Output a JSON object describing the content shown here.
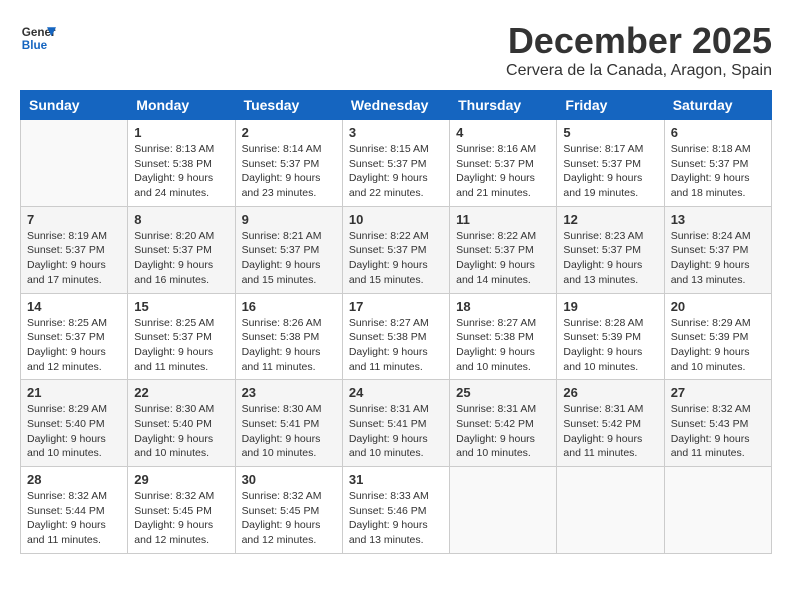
{
  "header": {
    "logo_line1": "General",
    "logo_line2": "Blue",
    "month": "December 2025",
    "location": "Cervera de la Canada, Aragon, Spain"
  },
  "weekdays": [
    "Sunday",
    "Monday",
    "Tuesday",
    "Wednesday",
    "Thursday",
    "Friday",
    "Saturday"
  ],
  "weeks": [
    [
      {
        "day": "",
        "info": ""
      },
      {
        "day": "1",
        "info": "Sunrise: 8:13 AM\nSunset: 5:38 PM\nDaylight: 9 hours\nand 24 minutes."
      },
      {
        "day": "2",
        "info": "Sunrise: 8:14 AM\nSunset: 5:37 PM\nDaylight: 9 hours\nand 23 minutes."
      },
      {
        "day": "3",
        "info": "Sunrise: 8:15 AM\nSunset: 5:37 PM\nDaylight: 9 hours\nand 22 minutes."
      },
      {
        "day": "4",
        "info": "Sunrise: 8:16 AM\nSunset: 5:37 PM\nDaylight: 9 hours\nand 21 minutes."
      },
      {
        "day": "5",
        "info": "Sunrise: 8:17 AM\nSunset: 5:37 PM\nDaylight: 9 hours\nand 19 minutes."
      },
      {
        "day": "6",
        "info": "Sunrise: 8:18 AM\nSunset: 5:37 PM\nDaylight: 9 hours\nand 18 minutes."
      }
    ],
    [
      {
        "day": "7",
        "info": "Sunrise: 8:19 AM\nSunset: 5:37 PM\nDaylight: 9 hours\nand 17 minutes."
      },
      {
        "day": "8",
        "info": "Sunrise: 8:20 AM\nSunset: 5:37 PM\nDaylight: 9 hours\nand 16 minutes."
      },
      {
        "day": "9",
        "info": "Sunrise: 8:21 AM\nSunset: 5:37 PM\nDaylight: 9 hours\nand 15 minutes."
      },
      {
        "day": "10",
        "info": "Sunrise: 8:22 AM\nSunset: 5:37 PM\nDaylight: 9 hours\nand 15 minutes."
      },
      {
        "day": "11",
        "info": "Sunrise: 8:22 AM\nSunset: 5:37 PM\nDaylight: 9 hours\nand 14 minutes."
      },
      {
        "day": "12",
        "info": "Sunrise: 8:23 AM\nSunset: 5:37 PM\nDaylight: 9 hours\nand 13 minutes."
      },
      {
        "day": "13",
        "info": "Sunrise: 8:24 AM\nSunset: 5:37 PM\nDaylight: 9 hours\nand 13 minutes."
      }
    ],
    [
      {
        "day": "14",
        "info": "Sunrise: 8:25 AM\nSunset: 5:37 PM\nDaylight: 9 hours\nand 12 minutes."
      },
      {
        "day": "15",
        "info": "Sunrise: 8:25 AM\nSunset: 5:37 PM\nDaylight: 9 hours\nand 11 minutes."
      },
      {
        "day": "16",
        "info": "Sunrise: 8:26 AM\nSunset: 5:38 PM\nDaylight: 9 hours\nand 11 minutes."
      },
      {
        "day": "17",
        "info": "Sunrise: 8:27 AM\nSunset: 5:38 PM\nDaylight: 9 hours\nand 11 minutes."
      },
      {
        "day": "18",
        "info": "Sunrise: 8:27 AM\nSunset: 5:38 PM\nDaylight: 9 hours\nand 10 minutes."
      },
      {
        "day": "19",
        "info": "Sunrise: 8:28 AM\nSunset: 5:39 PM\nDaylight: 9 hours\nand 10 minutes."
      },
      {
        "day": "20",
        "info": "Sunrise: 8:29 AM\nSunset: 5:39 PM\nDaylight: 9 hours\nand 10 minutes."
      }
    ],
    [
      {
        "day": "21",
        "info": "Sunrise: 8:29 AM\nSunset: 5:40 PM\nDaylight: 9 hours\nand 10 minutes."
      },
      {
        "day": "22",
        "info": "Sunrise: 8:30 AM\nSunset: 5:40 PM\nDaylight: 9 hours\nand 10 minutes."
      },
      {
        "day": "23",
        "info": "Sunrise: 8:30 AM\nSunset: 5:41 PM\nDaylight: 9 hours\nand 10 minutes."
      },
      {
        "day": "24",
        "info": "Sunrise: 8:31 AM\nSunset: 5:41 PM\nDaylight: 9 hours\nand 10 minutes."
      },
      {
        "day": "25",
        "info": "Sunrise: 8:31 AM\nSunset: 5:42 PM\nDaylight: 9 hours\nand 10 minutes."
      },
      {
        "day": "26",
        "info": "Sunrise: 8:31 AM\nSunset: 5:42 PM\nDaylight: 9 hours\nand 11 minutes."
      },
      {
        "day": "27",
        "info": "Sunrise: 8:32 AM\nSunset: 5:43 PM\nDaylight: 9 hours\nand 11 minutes."
      }
    ],
    [
      {
        "day": "28",
        "info": "Sunrise: 8:32 AM\nSunset: 5:44 PM\nDaylight: 9 hours\nand 11 minutes."
      },
      {
        "day": "29",
        "info": "Sunrise: 8:32 AM\nSunset: 5:45 PM\nDaylight: 9 hours\nand 12 minutes."
      },
      {
        "day": "30",
        "info": "Sunrise: 8:32 AM\nSunset: 5:45 PM\nDaylight: 9 hours\nand 12 minutes."
      },
      {
        "day": "31",
        "info": "Sunrise: 8:33 AM\nSunset: 5:46 PM\nDaylight: 9 hours\nand 13 minutes."
      },
      {
        "day": "",
        "info": ""
      },
      {
        "day": "",
        "info": ""
      },
      {
        "day": "",
        "info": ""
      }
    ]
  ]
}
